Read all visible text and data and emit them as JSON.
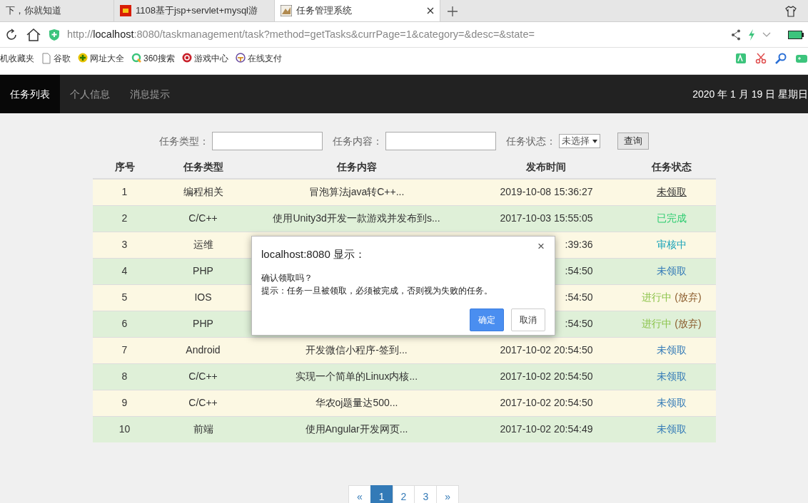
{
  "browser": {
    "tabs": [
      {
        "title": "下，你就知道",
        "selected": false
      },
      {
        "title": "1108基于jsp+servlet+mysql游",
        "selected": false
      },
      {
        "title": "任务管理系统",
        "selected": true
      }
    ],
    "url": {
      "prefix": "http://",
      "host": "localhost",
      "rest": ":8080/taskmanagement/task?method=getTasks&currPage=1&category=&desc=&state="
    },
    "bookmarks": [
      "机收藏夹",
      "谷歌",
      "网址大全",
      "360搜索",
      "游戏中心",
      "在线支付"
    ]
  },
  "navbar": {
    "items": [
      {
        "label": "任务列表",
        "selected": true
      },
      {
        "label": "个人信息",
        "selected": false
      },
      {
        "label": "消息提示",
        "selected": false
      }
    ],
    "date": "2020 年 1 月 19 日 星期日"
  },
  "filters": {
    "category_label": "任务类型：",
    "content_label": "任务内容：",
    "state_label": "任务状态：",
    "state_value": "未选择",
    "button": "查询"
  },
  "table": {
    "columns": [
      "序号",
      "任务类型",
      "任务内容",
      "发布时间",
      "任务状态"
    ],
    "rows": [
      {
        "no": "1",
        "category": "编程相关",
        "content": "冒泡算法java转C++...",
        "time": "2019-10-08 15:36:27",
        "status": "未领取",
        "kind": "unclaimed",
        "hovered": true
      },
      {
        "no": "2",
        "category": "C/C++",
        "content": "使用Unity3d开发一款游戏并发布到s...",
        "time": "2017-10-03 15:55:05",
        "status": "已完成",
        "kind": "done",
        "hovered": false
      },
      {
        "no": "3",
        "category": "运维",
        "time": ":39:36",
        "status": "审核中",
        "kind": "review",
        "hovered": false
      },
      {
        "no": "4",
        "category": "PHP",
        "time": ":54:50",
        "status": "未领取",
        "kind": "unclaimed",
        "hovered": false
      },
      {
        "no": "5",
        "category": "IOS",
        "time": ":54:50",
        "status": "进行中",
        "action": "(放弃)",
        "kind": "progress",
        "hovered": false
      },
      {
        "no": "6",
        "category": "PHP",
        "time": ":54:50",
        "status": "进行中",
        "action": "(放弃)",
        "kind": "progress",
        "hovered": false
      },
      {
        "no": "7",
        "category": "Android",
        "content": "开发微信小程序-签到...",
        "time": "2017-10-02 20:54:50",
        "status": "未领取",
        "kind": "unclaimed",
        "hovered": false
      },
      {
        "no": "8",
        "category": "C/C++",
        "content": "实现一个简单的Linux内核...",
        "time": "2017-10-02 20:54:50",
        "status": "未领取",
        "kind": "unclaimed",
        "hovered": false
      },
      {
        "no": "9",
        "category": "C/C++",
        "content": "华农oj题量达500...",
        "time": "2017-10-02 20:54:50",
        "status": "未领取",
        "kind": "unclaimed",
        "hovered": false
      },
      {
        "no": "10",
        "category": "前端",
        "content": "使用Angular开发网页...",
        "time": "2017-10-02 20:54:49",
        "status": "未领取",
        "kind": "unclaimed",
        "hovered": false
      }
    ]
  },
  "pagination": {
    "prev": "«",
    "pages": [
      {
        "label": "1",
        "selected": true
      },
      {
        "label": "2",
        "selected": false
      },
      {
        "label": "3",
        "selected": false
      }
    ],
    "next": "»"
  },
  "dialog": {
    "title": "localhost:8080 显示：",
    "close": "×",
    "lines": [
      "确认领取吗？",
      "提示：任务一旦被领取，必须被完成，否则视为失败的任务。"
    ],
    "buttons": [
      {
        "label": "确定",
        "selected": true
      },
      {
        "label": "取消",
        "selected": false
      }
    ]
  }
}
